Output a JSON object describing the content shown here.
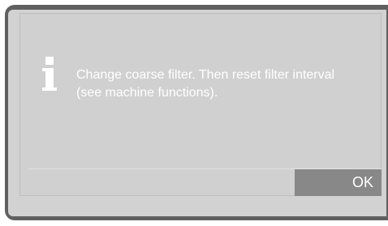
{
  "dialog": {
    "icon": "info-icon",
    "message": "Change coarse filter. Then reset filter interval (see machine functions).",
    "ok_label": "OK"
  },
  "colors": {
    "bezel": "#606060",
    "screen": "#d2d2d2",
    "text": "#ffffff",
    "button": "#888888"
  }
}
